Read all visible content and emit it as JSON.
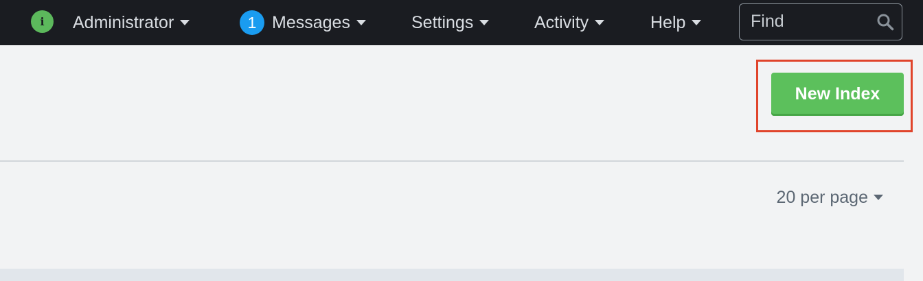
{
  "topbar": {
    "status_icon_glyph": "i",
    "nav": {
      "administrator": "Administrator",
      "messages_badge": "1",
      "messages": "Messages",
      "settings": "Settings",
      "activity": "Activity",
      "help": "Help"
    },
    "search_placeholder": "Find"
  },
  "toolbar": {
    "new_index_label": "New Index"
  },
  "pagination": {
    "per_page_label": "20 per page"
  },
  "colors": {
    "topbar_bg": "#1a1c21",
    "accent_green": "#5cc05c",
    "badge_blue": "#1a9cf0",
    "highlight_red": "#e0442b",
    "page_bg": "#f2f3f4"
  },
  "icons": [
    "info-icon",
    "caret-down-icon",
    "search-icon"
  ]
}
